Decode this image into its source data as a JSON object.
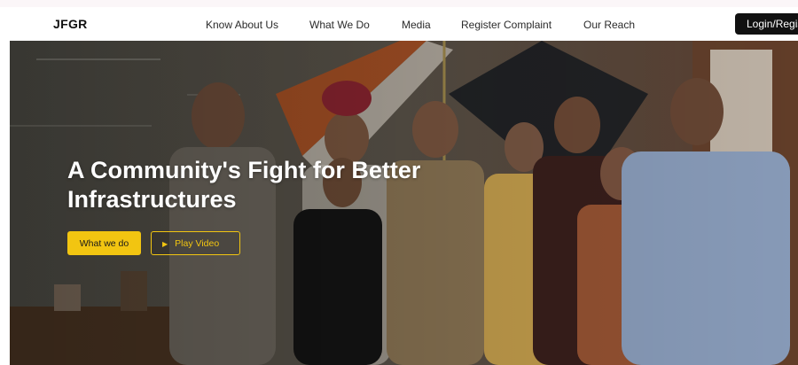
{
  "brand": {
    "name": "JFGR"
  },
  "nav": {
    "items": [
      {
        "label": "Know About Us"
      },
      {
        "label": "What We Do"
      },
      {
        "label": "Media"
      },
      {
        "label": "Register Complaint"
      },
      {
        "label": "Our Reach"
      }
    ],
    "login_label": "Login/Register"
  },
  "hero": {
    "headline_line1": "A Community's Fight for Better",
    "headline_line2": "Infrastructures",
    "primary_button": "What we do",
    "secondary_button": "Play Video",
    "secondary_icon": "play-icon",
    "accent_color": "#f2c511"
  }
}
